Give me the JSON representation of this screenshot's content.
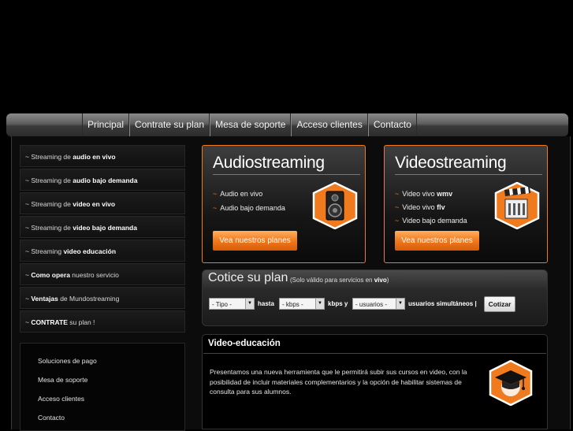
{
  "nav": {
    "items": [
      {
        "label": "Principal"
      },
      {
        "label": "Contrate su plan"
      },
      {
        "label": "Mesa de soporte"
      },
      {
        "label": "Acceso clientes"
      },
      {
        "label": "Contacto"
      }
    ]
  },
  "sidebar": {
    "menu": [
      {
        "prefix": "~ Streaming de ",
        "bold": "audio en vivo",
        "suffix": ""
      },
      {
        "prefix": "~ Streaming de ",
        "bold": "audio bajo demanda",
        "suffix": ""
      },
      {
        "prefix": "~ Streaming de ",
        "bold": "video en vivo",
        "suffix": ""
      },
      {
        "prefix": "~ Streaming de ",
        "bold": "video bajo demanda",
        "suffix": ""
      },
      {
        "prefix": "~ Streaming ",
        "bold": "video educación",
        "suffix": ""
      },
      {
        "prefix": "~ ",
        "bold": "Como opera",
        "suffix": " nuestro servicio"
      },
      {
        "prefix": "~ ",
        "bold": "Ventajas",
        "suffix": " de Mundostreaming"
      },
      {
        "prefix": "~ ",
        "bold": "CONTRATE",
        "suffix": " su plan !"
      }
    ],
    "links": [
      {
        "label": "Soluciones de pago"
      },
      {
        "label": "Mesa de soporte"
      },
      {
        "label": "Acceso clientes"
      },
      {
        "label": "Contacto"
      }
    ]
  },
  "promos": {
    "audio": {
      "title": "Audiostreaming",
      "dash": "~",
      "features": [
        "Audio en vivo",
        "Audio bajo demanda"
      ],
      "button": "Vea nuestros planes",
      "icon": "speaker-icon"
    },
    "video": {
      "title": "Videostreaming",
      "dash": "~",
      "features": [
        {
          "text": "Video vivo ",
          "bold": "wmv"
        },
        {
          "text": "Video vivo ",
          "bold": "flv"
        },
        {
          "text": "Video bajo demanda",
          "bold": ""
        }
      ],
      "button": "Vea nuestros planes",
      "icon": "film-clapper-icon"
    }
  },
  "quote": {
    "title": "Cotice su plan",
    "note_prefix": "(Solo válido para servicios en ",
    "note_bold": "vivo",
    "note_suffix": ")",
    "type_select": "- Tipo -",
    "hasta_label": "hasta",
    "kbps_select": "- kbps -",
    "kbps_label": "kbps y",
    "users_select": "- usuarios -",
    "users_label": "usuarios simultáneos |",
    "button": "Cotizar"
  },
  "content": {
    "title": "Video-educación",
    "body": "Presentamos una nueva herramienta que le permitirá subir sus cursos en video, con la posibilidad de incluir materiales complementarios y la opción de habilitar sistemas de consulta para sus alumnos.",
    "icon": "graduation-cap-icon"
  },
  "colors": {
    "accent": "#f07a1e",
    "background": "#000000"
  }
}
